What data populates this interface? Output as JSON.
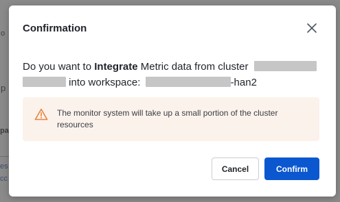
{
  "backdrop": {
    "fragments": [
      "o",
      "p",
      "pa",
      "es",
      "cc"
    ]
  },
  "dialog": {
    "title": "Confirmation",
    "close_icon": "close-icon",
    "message": {
      "prefix": "Do you want to ",
      "action": "Integrate",
      "middle": " Metric data from cluster ",
      "line2_tail": " into workspace: ",
      "workspace_suffix": "-han2"
    },
    "warning": {
      "icon": "warning-triangle-icon",
      "icon_color": "#e8833a",
      "background": "#fbf2ec",
      "text": "The monitor system will take up a small portion of the cluster resources"
    },
    "buttons": {
      "cancel_label": "Cancel",
      "confirm_label": "Confirm",
      "confirm_color": "#0b57d0"
    }
  }
}
